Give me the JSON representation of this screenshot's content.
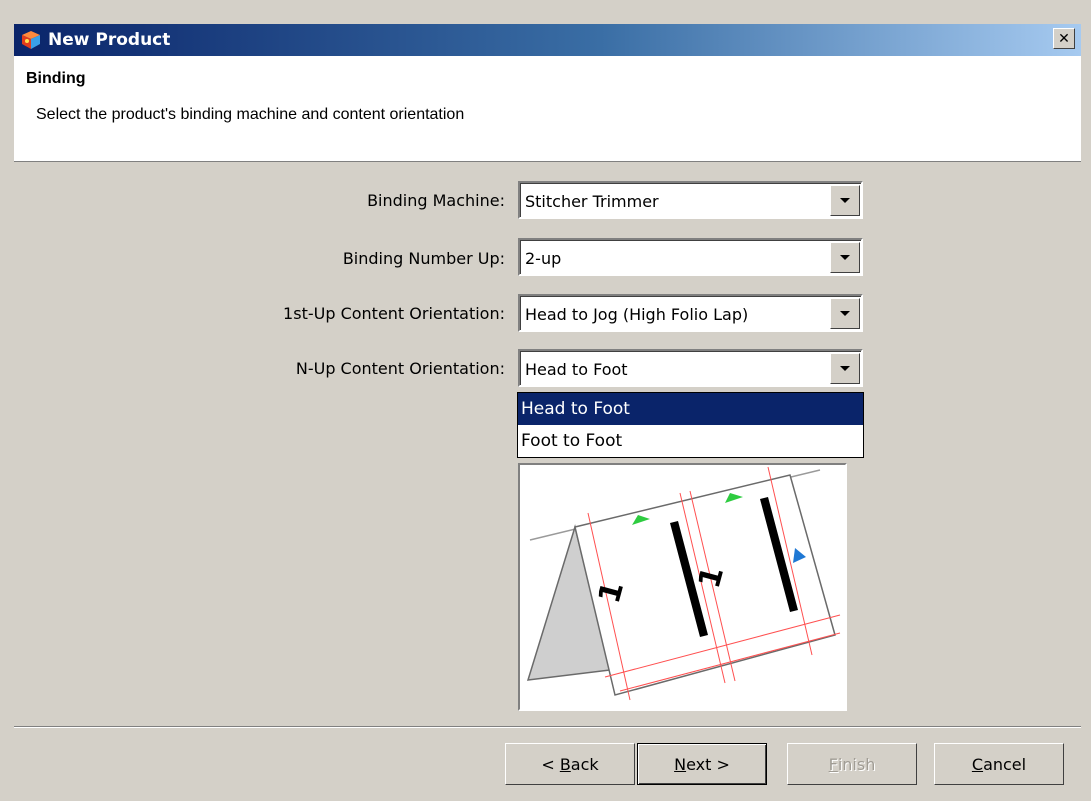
{
  "window": {
    "title": "New Product",
    "close_glyph": "✕"
  },
  "header": {
    "title": "Binding",
    "subtitle": "Select the product's binding machine and content orientation"
  },
  "form": {
    "binding_machine": {
      "label": "Binding Machine:",
      "value": "Stitcher Trimmer"
    },
    "binding_number_up": {
      "label": "Binding Number Up:",
      "value": "2-up"
    },
    "first_up_orientation": {
      "label": "1st-Up Content Orientation:",
      "value": "Head to Jog (High Folio Lap)"
    },
    "n_up_orientation": {
      "label": "N-Up Content Orientation:",
      "value": "Head to Foot",
      "options": [
        "Head to Foot",
        "Foot to Foot"
      ]
    }
  },
  "preview": {
    "page_number_1": "1",
    "page_number_2": "1",
    "marker_colors": {
      "green": "#2ecc40",
      "blue": "#1e78d4",
      "guides": "#ff4040"
    }
  },
  "buttons": {
    "back": {
      "prefix": "< ",
      "mnemonic": "B",
      "rest": "ack"
    },
    "next": {
      "mnemonic": "N",
      "rest": "ext >"
    },
    "finish": {
      "mnemonic": "F",
      "rest": "inish"
    },
    "cancel": {
      "mnemonic": "C",
      "rest": "ancel"
    }
  },
  "colors": {
    "title_bar_start": "#0a246a",
    "title_bar_end": "#a6caf0",
    "dialog_bg": "#d4d0c8",
    "selection": "#0a246a"
  }
}
